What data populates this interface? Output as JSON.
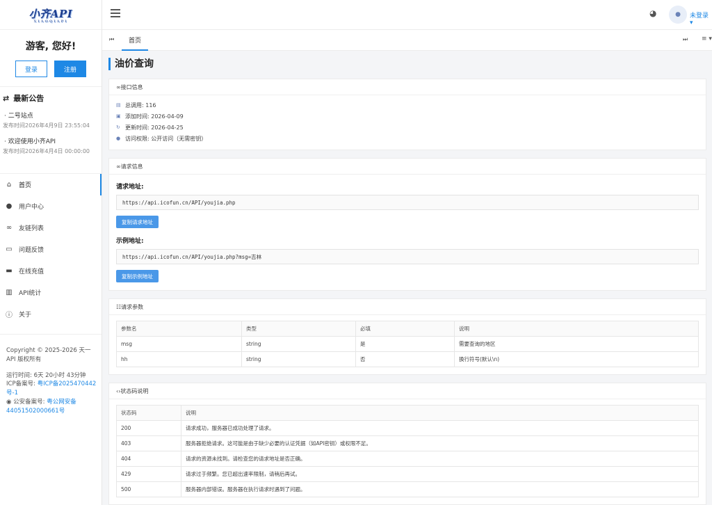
{
  "brand": {
    "logo_text": "小齐API",
    "logo_sub": "XIAOQIAPI"
  },
  "sidebar": {
    "greeting": "游客, 您好!",
    "login_label": "登录",
    "register_label": "注册",
    "notice_title": "最新公告",
    "notices": [
      {
        "title": "二号站点",
        "time": "发布时间2026年4月9日 23:55:04"
      },
      {
        "title": "欢迎使用小齐API",
        "time": "发布时间2026年4月4日 00:00:00"
      }
    ],
    "nav": [
      {
        "label": "首页",
        "icon": "home-icon"
      },
      {
        "label": "用户中心",
        "icon": "user-icon"
      },
      {
        "label": "友链列表",
        "icon": "link-icon"
      },
      {
        "label": "问题反馈",
        "icon": "feedback-icon"
      },
      {
        "label": "在线充值",
        "icon": "card-icon"
      },
      {
        "label": "API统计",
        "icon": "bar-chart-icon"
      },
      {
        "label": "关于",
        "icon": "info-icon"
      }
    ],
    "footer": {
      "copyright": "Copyright © 2025-2026 天一API 版权所有",
      "runtime": "运行时间: 6天 20小时 43分钟",
      "icp_label": "ICP备案号:",
      "icp_value": "粤ICP备2025470442号-1",
      "police_label": "公安备案号:",
      "police_value": "粤公网安备44051502000661号"
    }
  },
  "topbar": {
    "login_status": "未登录"
  },
  "tabs": {
    "home": "首页"
  },
  "page": {
    "title": "油价查询"
  },
  "info": {
    "header": "接口信息",
    "rows": [
      {
        "label": "总调用: 116"
      },
      {
        "label": "添加时间: 2026-04-09"
      },
      {
        "label": "更新时间: 2026-04-25"
      },
      {
        "label": "访问权限: 公开访问（无需密钥）"
      }
    ]
  },
  "request": {
    "header": "请求信息",
    "url_label": "请求地址:",
    "url": "https://api.icofun.cn/API/youjia.php",
    "copy_url": "复制请求地址",
    "example_label": "示例地址:",
    "example": "https://api.icofun.cn/API/youjia.php?msg=吉林",
    "copy_example": "复制示例地址"
  },
  "params": {
    "header": "请求参数",
    "columns": [
      "参数名",
      "类型",
      "必填",
      "说明"
    ],
    "rows": [
      [
        "msg",
        "string",
        "是",
        "需要查询的地区"
      ],
      [
        "hh",
        "string",
        "否",
        "换行符号(默认\\n)"
      ]
    ]
  },
  "status": {
    "header": "状态码说明",
    "columns": [
      "状态码",
      "说明"
    ],
    "rows": [
      [
        "200",
        "请求成功，服务器已成功处理了请求。"
      ],
      [
        "403",
        "服务器拒绝请求。这可能是由于缺少必要的认证凭据（如API密钥）或权限不足。"
      ],
      [
        "404",
        "请求的资源未找到。请检查您的请求地址是否正确。"
      ],
      [
        "429",
        "请求过于频繁。您已超出速率限制，请稍后再试。"
      ],
      [
        "500",
        "服务器内部错误。服务器在执行请求时遇到了问题。"
      ]
    ]
  }
}
